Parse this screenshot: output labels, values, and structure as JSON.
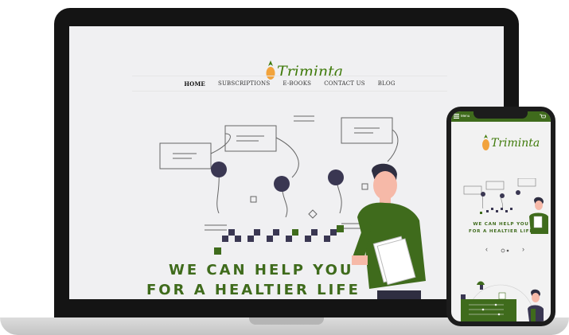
{
  "desktop": {
    "logo_text": "Triminta",
    "nav": [
      "HOME",
      "SUBSCRIPTIONS",
      "E-BOOKS",
      "CONTACT US",
      "BLOG"
    ],
    "hero_line1": "WE CAN HELP YOU",
    "hero_line2": "FOR  A HEALTIER LIFE"
  },
  "mobile": {
    "menu_label": "Menu",
    "logo_text": "Triminta",
    "hero_line1": "WE CAN HELP YOU",
    "hero_line2": "FOR  A HEALTIER LIFE",
    "prev_arrow": "‹",
    "next_arrow": "›"
  },
  "colors": {
    "brand_green": "#3f6b1c",
    "pineapple": "#f2a33c",
    "accent_dark": "#3a3752"
  }
}
